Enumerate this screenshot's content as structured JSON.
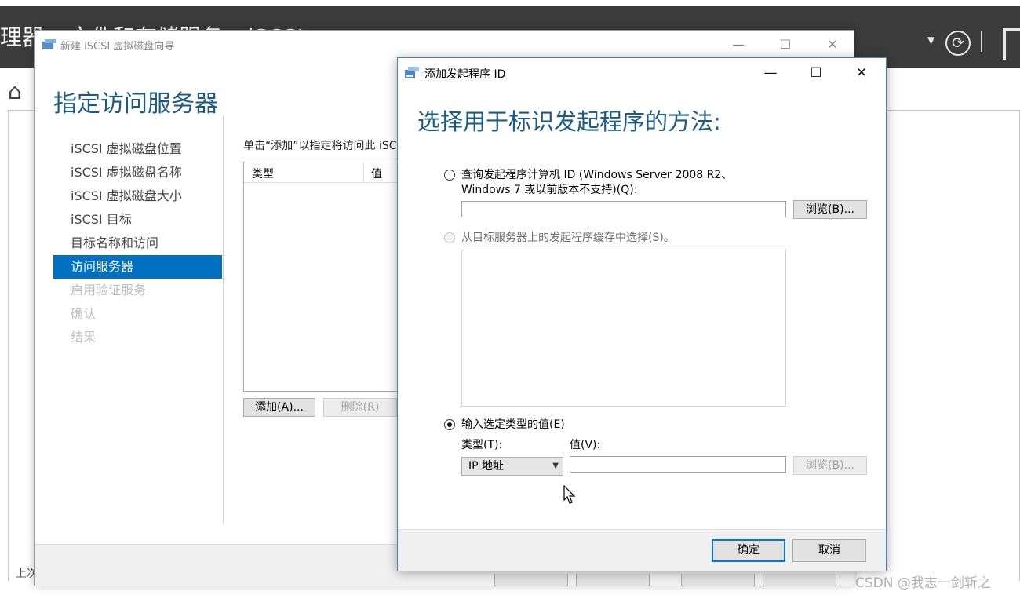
{
  "server_manager": {
    "title_fragment": "理器 ▸ 文件和存储服务 ▸ iSCSI",
    "bottom_text": "上次"
  },
  "wizard": {
    "window_title": "新建 iSCSI 虚拟磁盘向导",
    "heading": "指定访问服务器",
    "nav_items": [
      {
        "label": "iSCSI 虚拟磁盘位置",
        "state": "normal"
      },
      {
        "label": "iSCSI 虚拟磁盘名称",
        "state": "normal"
      },
      {
        "label": "iSCSI 虚拟磁盘大小",
        "state": "normal"
      },
      {
        "label": "iSCSI 目标",
        "state": "normal"
      },
      {
        "label": "目标名称和访问",
        "state": "normal"
      },
      {
        "label": "访问服务器",
        "state": "active"
      },
      {
        "label": "启用验证服务",
        "state": "disabled"
      },
      {
        "label": "确认",
        "state": "disabled"
      },
      {
        "label": "结果",
        "state": "disabled"
      }
    ],
    "instruction": "单击“添加”以指定将访问此 iSC",
    "list_columns": {
      "type": "类型",
      "value": "值"
    },
    "add_button": "添加(A)...",
    "remove_button": "删除(R)"
  },
  "dialog": {
    "title": "添加发起程序 ID",
    "heading": "选择用于标识发起程序的方法:",
    "option_query": {
      "line1": "查询发起程序计算机 ID (Windows Server 2008 R2、",
      "line2": "Windows 7 或以前版本不支持)(Q):",
      "browse": "浏览(B)..."
    },
    "option_cache": {
      "label": "从目标服务器上的发起程序缓存中选择(S)。"
    },
    "option_enter": {
      "label": "输入选定类型的值(E)",
      "type_label": "类型(T):",
      "value_label": "值(V):",
      "type_selected": "IP 地址",
      "value": "",
      "browse": "浏览(B)..."
    },
    "ok_button": "确定",
    "cancel_button": "取消"
  },
  "window_controls": {
    "minimize": "—",
    "maximize": "☐",
    "close": "✕"
  },
  "watermark": "CSDN @我志一剑斩之",
  "colors": {
    "accent": "#0070c0",
    "heading": "#1a5c86",
    "sm_bar": "#3c3c3c"
  }
}
